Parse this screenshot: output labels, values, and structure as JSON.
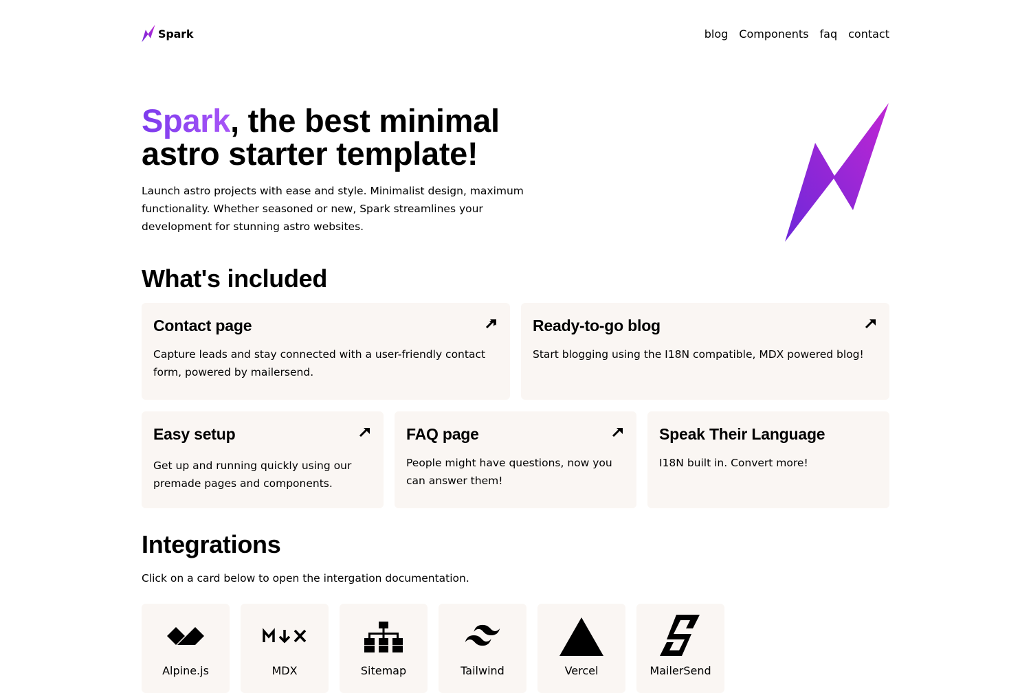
{
  "header": {
    "logo_text": "Spark",
    "nav": [
      "blog",
      "Components",
      "faq",
      "contact"
    ]
  },
  "hero": {
    "title_brand": "Spark",
    "title_rest": ", the best minimal astro starter template!",
    "description": "Launch astro projects with ease and style. Minimalist design, maximum functionality. Whether seasoned or new, Spark streamlines your development for stunning astro websites.",
    "gradient": [
      "#6d28d9",
      "#c026d3"
    ]
  },
  "included": {
    "title": "What's included",
    "cards": [
      {
        "title": "Contact page",
        "text": "Capture leads and stay connected with a user-friendly contact form, powered by mailersend.",
        "icon": "arrow-up-right-icon"
      },
      {
        "title": "Ready-to-go blog",
        "text": "Start blogging using the I18N compatible, MDX powered blog!",
        "icon": "arrow-up-right-icon"
      },
      {
        "title": "Easy setup",
        "text": "Get up and running quickly using our premade pages and components.",
        "icon": "arrow-up-right-icon"
      },
      {
        "title": "FAQ page",
        "text": "People might have questions, now you can answer them!",
        "icon": "arrow-up-right-icon"
      },
      {
        "title": "Speak Their Language",
        "text": "I18N built in. Convert more!"
      }
    ]
  },
  "integrations": {
    "title": "Integrations",
    "description": "Click on a card below to open the intergation documentation.",
    "items": [
      {
        "label": "Alpine.js",
        "icon": "alpinejs-icon"
      },
      {
        "label": "MDX",
        "icon": "mdx-icon"
      },
      {
        "label": "Sitemap",
        "icon": "sitemap-icon"
      },
      {
        "label": "Tailwind",
        "icon": "tailwind-icon"
      },
      {
        "label": "Vercel",
        "icon": "vercel-icon"
      },
      {
        "label": "MailerSend",
        "icon": "mailersend-icon"
      }
    ]
  },
  "colors": {
    "card_bg": "#faf6f3",
    "brand_purple": "#7c3aed"
  }
}
